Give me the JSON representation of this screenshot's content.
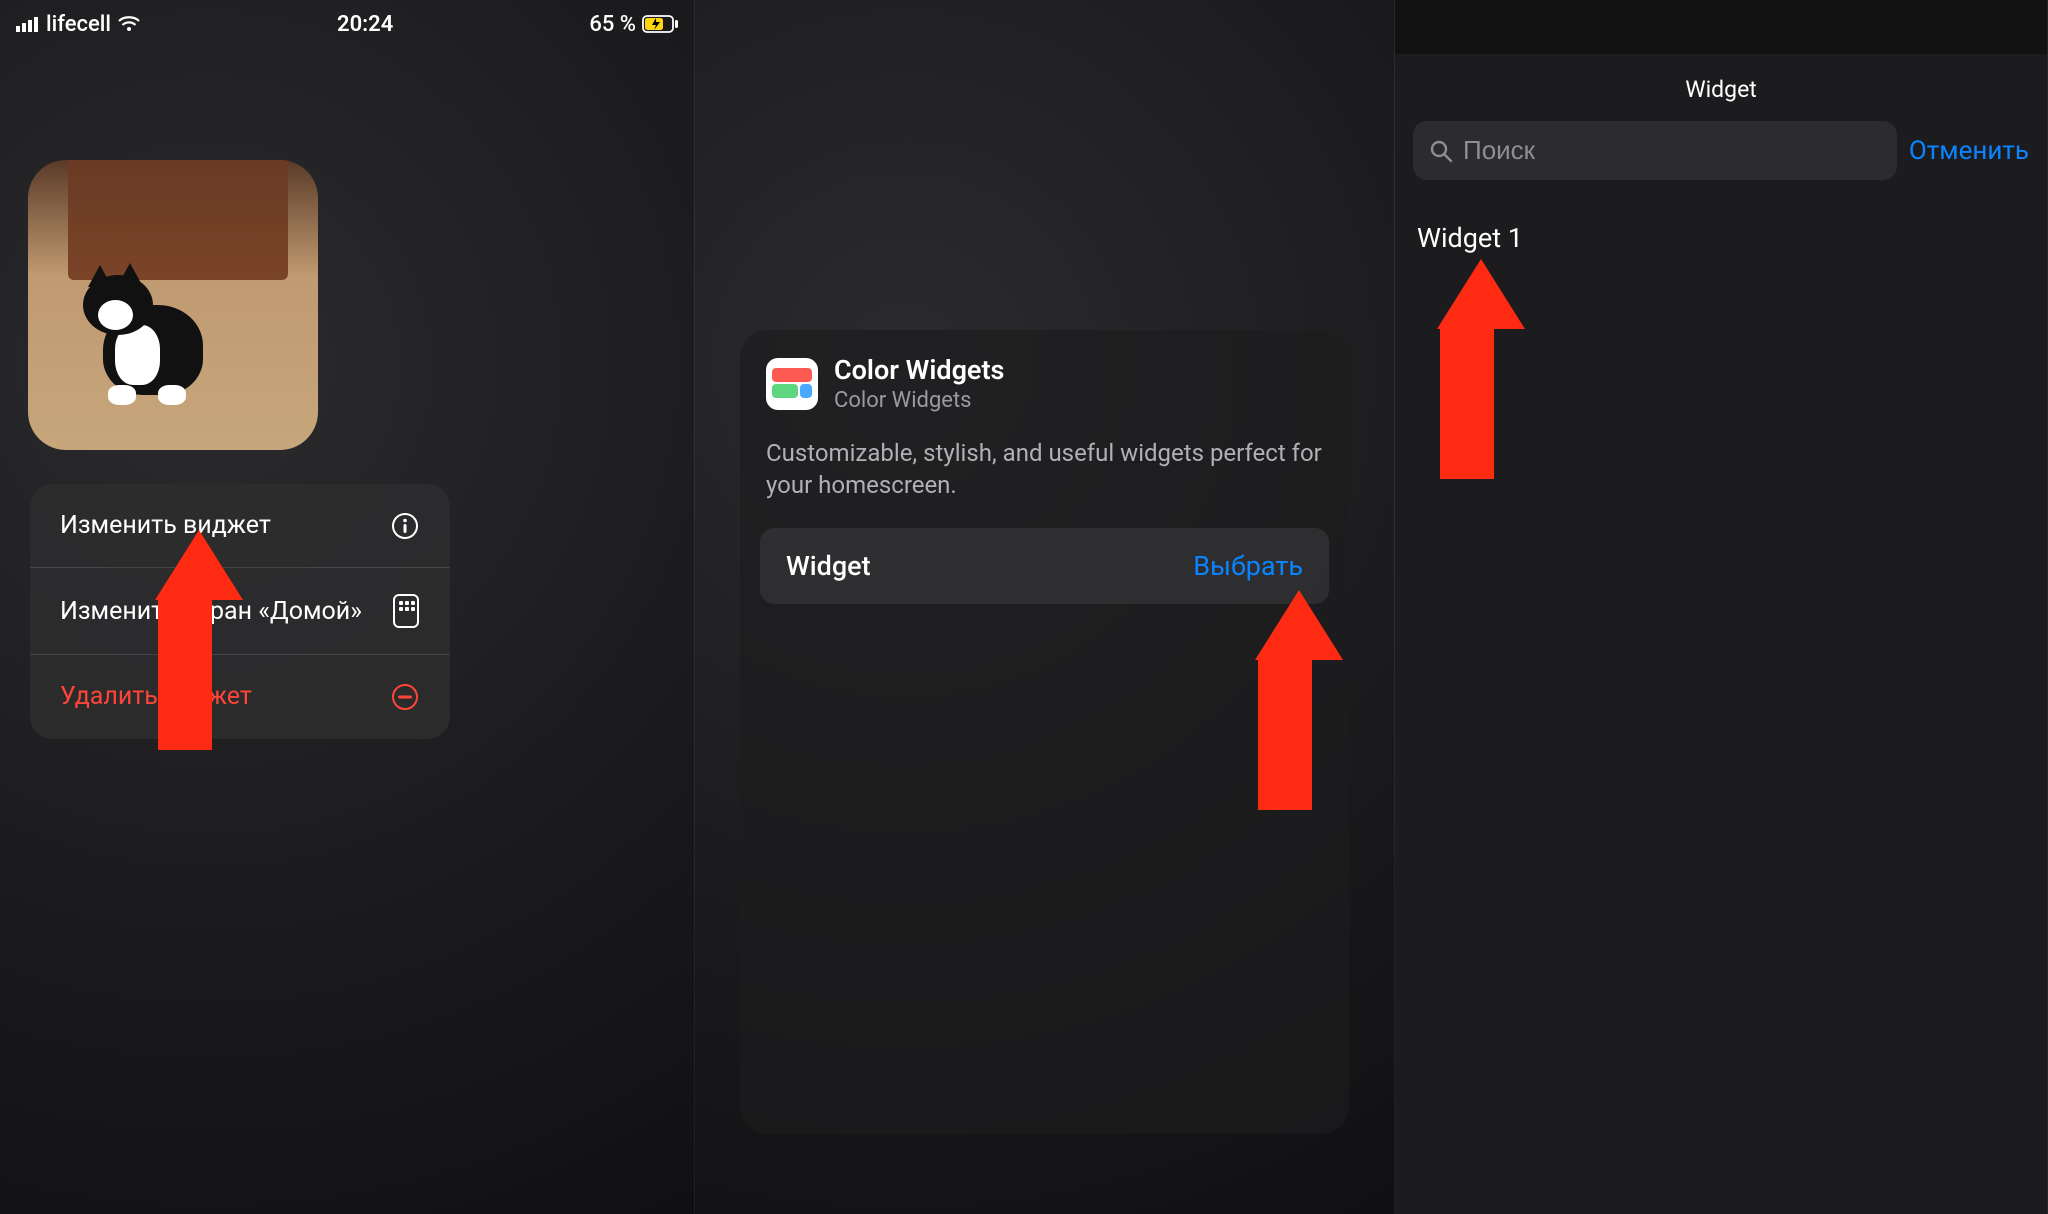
{
  "statusbar": {
    "carrier": "lifecell",
    "time": "20:24",
    "battery_text": "65 %"
  },
  "context_menu": {
    "edit_widget": "Изменить виджет",
    "edit_home": "Изменить экран «Домой»",
    "remove_widget": "Удалить виджет"
  },
  "config": {
    "app_title": "Color Widgets",
    "app_sub": "Color Widgets",
    "description": "Customizable, stylish, and useful widgets perfect for your homescreen.",
    "row_label": "Widget",
    "row_action": "Выбрать"
  },
  "picker": {
    "title": "Widget",
    "search_placeholder": "Поиск",
    "cancel": "Отменить",
    "items": [
      "Widget 1"
    ]
  }
}
